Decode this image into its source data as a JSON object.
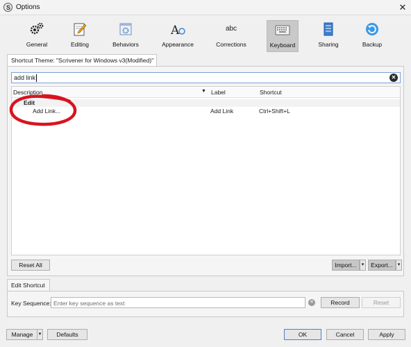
{
  "window": {
    "title": "Options",
    "close_glyph": "✕"
  },
  "toolbar": {
    "items": [
      {
        "label": "General",
        "icon": "gears-icon"
      },
      {
        "label": "Editing",
        "icon": "pencil-page-icon"
      },
      {
        "label": "Behaviors",
        "icon": "window-gear-icon"
      },
      {
        "label": "Appearance",
        "icon": "font-a-icon"
      },
      {
        "label": "Corrections",
        "icon": "abc-icon",
        "icon_text": "abc"
      },
      {
        "label": "Keyboard",
        "icon": "keyboard-icon",
        "selected": true
      },
      {
        "label": "Sharing",
        "icon": "sharing-icon"
      },
      {
        "label": "Backup",
        "icon": "backup-icon"
      }
    ]
  },
  "theme": {
    "label": "Shortcut Theme: \"Scrivener for Windows v3(Modified)\""
  },
  "search": {
    "value": "add link"
  },
  "table": {
    "columns": [
      "Description",
      "Label",
      "Shortcut"
    ],
    "group": "Edit",
    "rows": [
      {
        "description": "Add Link...",
        "label": "Add Link",
        "shortcut": "Ctrl+Shift+L"
      }
    ]
  },
  "buttons": {
    "reset_all": "Reset All",
    "import": "Import...",
    "export": "Export...",
    "record": "Record",
    "reset": "Reset",
    "manage": "Manage",
    "defaults": "Defaults",
    "ok": "OK",
    "cancel": "Cancel",
    "apply": "Apply",
    "dropdown_glyph": "▾"
  },
  "edit_shortcut": {
    "tab_label": "Edit Shortcut",
    "key_sequence_label": "Key Sequence:",
    "placeholder": "Enter key sequence as text"
  },
  "colors": {
    "annotation_red": "#d8141f",
    "selected_tab": "#c9c9c9"
  }
}
